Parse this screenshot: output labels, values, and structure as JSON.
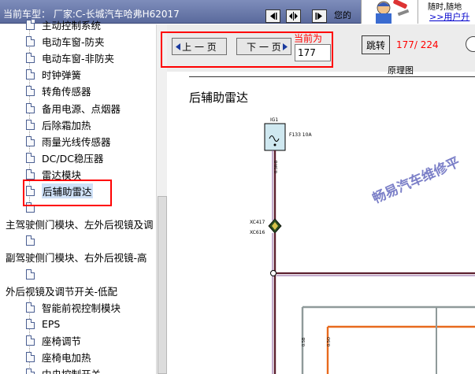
{
  "header": {
    "title": "当前车型：  厂家:C-长城汽车哈弗H62017",
    "marquee": "您的",
    "ad_line1": "随时,随地",
    "ad_line2": ">>用户升"
  },
  "tree": {
    "items": [
      {
        "label": "主动控制系统",
        "indent": 1
      },
      {
        "label": "电动车窗-防夹",
        "indent": 1
      },
      {
        "label": "电动车窗-非防夹",
        "indent": 1
      },
      {
        "label": "时钟弹簧",
        "indent": 1
      },
      {
        "label": "转角传感器",
        "indent": 1
      },
      {
        "label": "备用电源、点烟器",
        "indent": 1
      },
      {
        "label": "后除霜加热",
        "indent": 1
      },
      {
        "label": "雨量光线传感器",
        "indent": 1
      },
      {
        "label": "DC/DC稳压器",
        "indent": 1
      },
      {
        "label": "雷达模块",
        "indent": 1
      },
      {
        "label": "后辅助雷达",
        "indent": 1,
        "selected": true
      },
      {
        "label": "",
        "indent": 1
      },
      {
        "label": "主驾驶侧门模块、左外后视镜及调",
        "indent": 0
      },
      {
        "label": "",
        "indent": 1
      },
      {
        "label": "副驾驶侧门模块、右外后视镜-高",
        "indent": 0
      },
      {
        "label": "",
        "indent": 1
      },
      {
        "label": "外后视镜及调节开关-低配",
        "indent": 0
      },
      {
        "label": "智能前视控制模块",
        "indent": 1
      },
      {
        "label": "EPS",
        "indent": 1
      },
      {
        "label": "座椅调节",
        "indent": 1
      },
      {
        "label": "座椅电加热",
        "indent": 1
      },
      {
        "label": "中央控制开关",
        "indent": 1
      }
    ]
  },
  "toolbar": {
    "prev_label": "上 一 页",
    "next_label": "下 一 页",
    "current_page_label": "当前为",
    "current_page_value": "177",
    "jump_label": "跳转",
    "page_count": "177/ 224"
  },
  "diagram": {
    "header": "原理图",
    "title": "后辅助雷达",
    "watermark": "畅易汽车维修平",
    "fuse_id": "IG1",
    "fuse_spec": "F133  10A",
    "conn_label1": "XC417",
    "conn_label2": "XC616",
    "colors": {
      "wire_main": "#5c1f2e",
      "wire_purple": "#8a5a9e",
      "wire_gray": "#8f9a9a",
      "wire_orange": "#e86a1e",
      "fuse_box": "#cfe8f0"
    }
  }
}
